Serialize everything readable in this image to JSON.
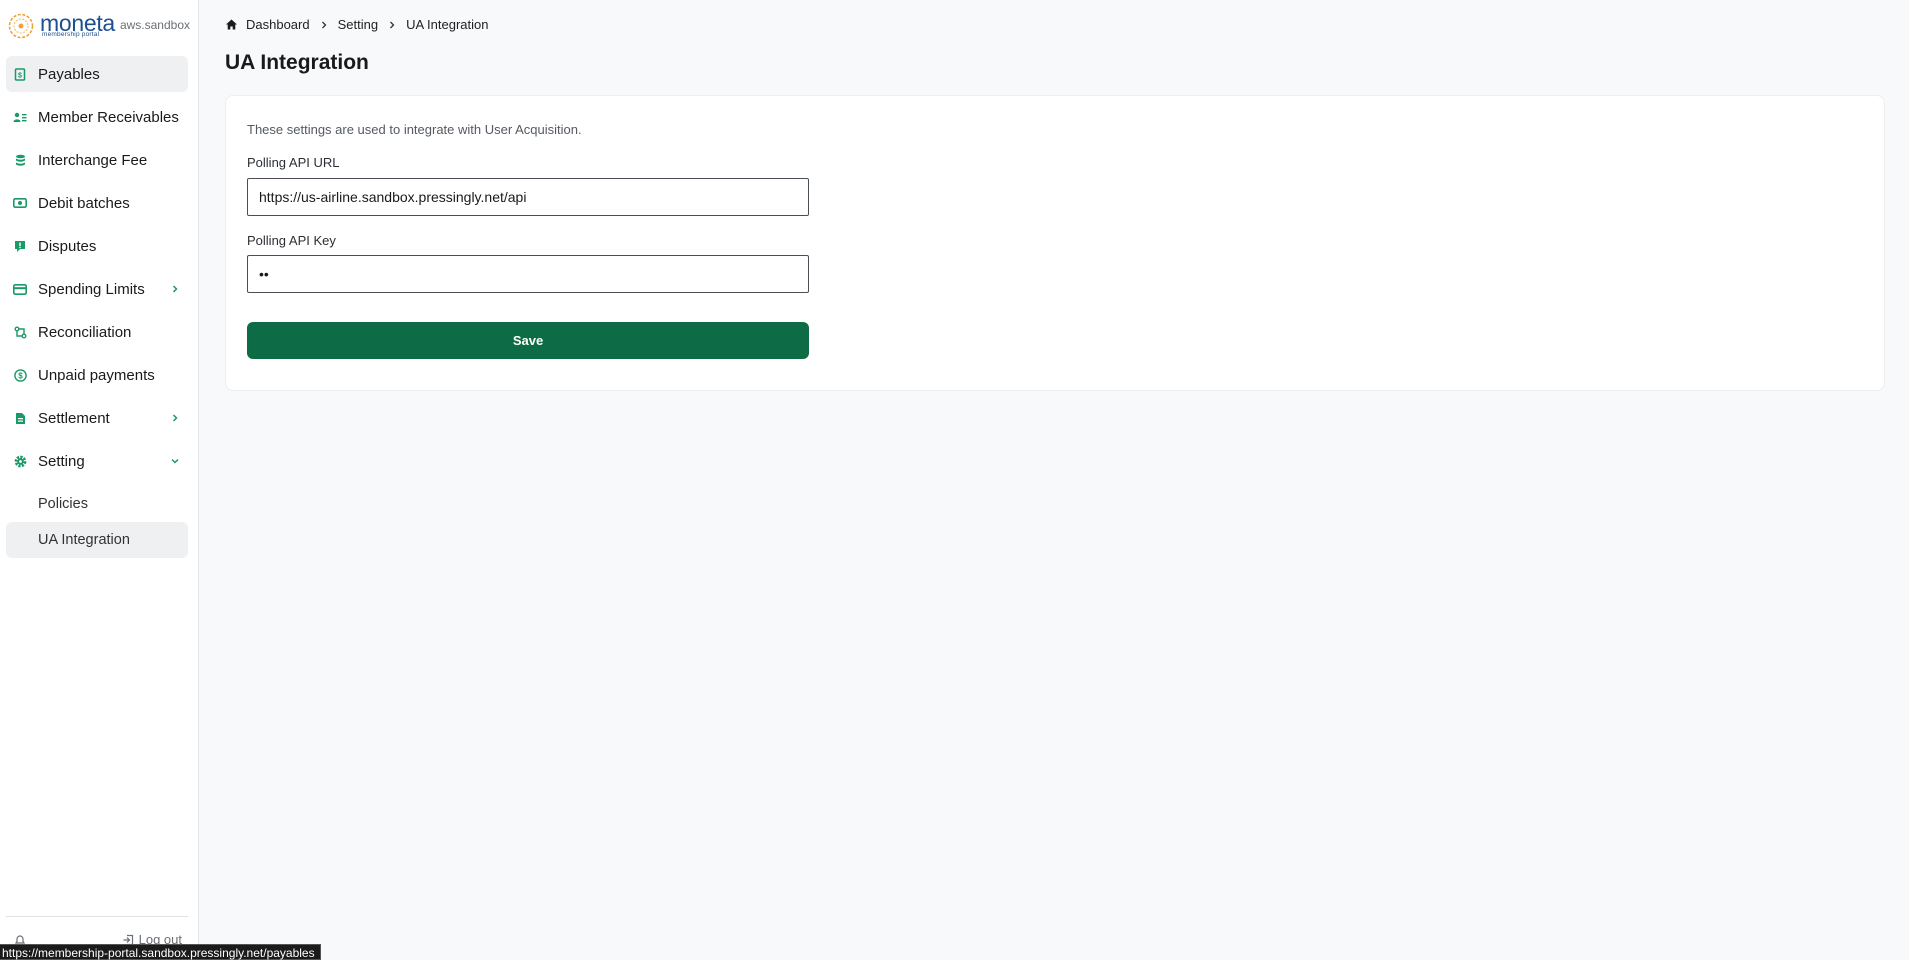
{
  "brand": {
    "name": "moneta",
    "tagline": "membership portal",
    "environment": "aws.sandbox"
  },
  "sidebar": {
    "items": [
      {
        "label": "Payables",
        "icon": "receipt-icon"
      },
      {
        "label": "Member Receivables",
        "icon": "members-icon"
      },
      {
        "label": "Interchange Fee",
        "icon": "coins-stack-icon"
      },
      {
        "label": "Debit batches",
        "icon": "cash-icon"
      },
      {
        "label": "Disputes",
        "icon": "alert-message-icon"
      },
      {
        "label": "Spending Limits",
        "icon": "credit-card-icon"
      },
      {
        "label": "Reconciliation",
        "icon": "reconcile-icon"
      },
      {
        "label": "Unpaid payments",
        "icon": "dollar-circle-icon"
      },
      {
        "label": "Settlement",
        "icon": "document-icon"
      },
      {
        "label": "Setting",
        "icon": "gear-icon"
      }
    ],
    "sub_items": [
      {
        "label": "Policies"
      },
      {
        "label": "UA Integration"
      }
    ],
    "logout_label": "Log out"
  },
  "breadcrumb": {
    "items": [
      "Dashboard",
      "Setting",
      "UA Integration"
    ]
  },
  "page": {
    "title": "UA Integration",
    "description": "These settings are used to integrate with User Acquisition.",
    "url_label": "Polling API URL",
    "url_value": "https://us-airline.sandbox.pressingly.net/api",
    "key_label": "Polling API Key",
    "key_value": "••",
    "save_label": "Save"
  },
  "status_bar": {
    "url": "https://membership-portal.sandbox.pressingly.net/payables"
  },
  "colors": {
    "accent": "#0d6b45",
    "icon_green": "#1a9a66",
    "brand_blue": "#1d4f91",
    "logo_orange": "#f0a33a"
  }
}
